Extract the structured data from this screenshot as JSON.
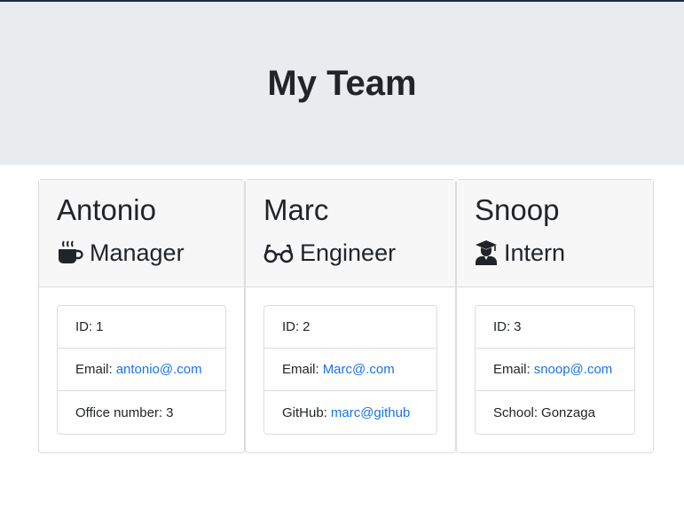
{
  "header": {
    "title": "My Team"
  },
  "colors": {
    "link": "#1a73e8",
    "jumbotron": "#e9ecef",
    "card_header": "#f7f7f7"
  },
  "cards": [
    {
      "name": "Antonio",
      "role": "Manager",
      "icon": "coffee-cup-icon",
      "items": [
        {
          "label": "ID:",
          "value": "1"
        },
        {
          "label": "Email:",
          "value": "antonio@.com"
        },
        {
          "label": "Office number:",
          "value": "3"
        }
      ]
    },
    {
      "name": "Marc",
      "role": "Engineer",
      "icon": "glasses-icon",
      "items": [
        {
          "label": "ID:",
          "value": "2"
        },
        {
          "label": "Email:",
          "value": "Marc@.com"
        },
        {
          "label": "GitHub:",
          "value": "marc@github"
        }
      ]
    },
    {
      "name": "Snoop",
      "role": "Intern",
      "icon": "graduate-icon",
      "items": [
        {
          "label": "ID:",
          "value": "3"
        },
        {
          "label": "Email:",
          "value": "snoop@.com"
        },
        {
          "label": "School:",
          "value": "Gonzaga"
        }
      ]
    }
  ]
}
